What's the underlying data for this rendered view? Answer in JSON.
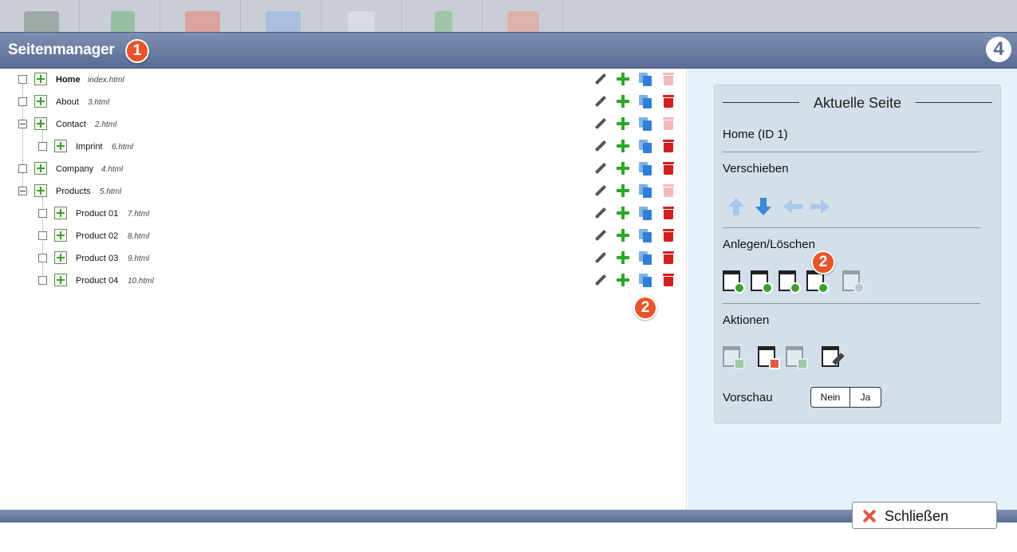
{
  "header": {
    "title": "Seitenmanager",
    "badge_1": "1",
    "logo_text": "4"
  },
  "tree": {
    "rows": [
      {
        "label": "Home",
        "file": "index.html"
      },
      {
        "label": "About",
        "file": "3.html"
      },
      {
        "label": "Contact",
        "file": "2.html"
      },
      {
        "label": "Imprint",
        "file": "6.html"
      },
      {
        "label": "Company",
        "file": "4.html"
      },
      {
        "label": "Products",
        "file": "5.html"
      },
      {
        "label": "Product 01",
        "file": "7.html"
      },
      {
        "label": "Product 02",
        "file": "8.html"
      },
      {
        "label": "Product 03",
        "file": "9.html"
      },
      {
        "label": "Product 04",
        "file": "10.html"
      }
    ],
    "badge_2": "2"
  },
  "panel": {
    "legend": "Aktuelle Seite",
    "current_page": "Home (ID 1)",
    "move_heading": "Verschieben",
    "create_heading": "Anlegen/Löschen",
    "badge_2": "2",
    "actions_heading": "Aktionen",
    "preview_label": "Vorschau",
    "preview_no": "Nein",
    "preview_yes": "Ja"
  },
  "footer": {
    "close_label": "Schließen"
  },
  "colors": {
    "accent": "#5a6c94",
    "badge": "#e8552d",
    "add": "#2fa62a",
    "copy": "#2f7fd8",
    "delete": "#d21f1f"
  }
}
